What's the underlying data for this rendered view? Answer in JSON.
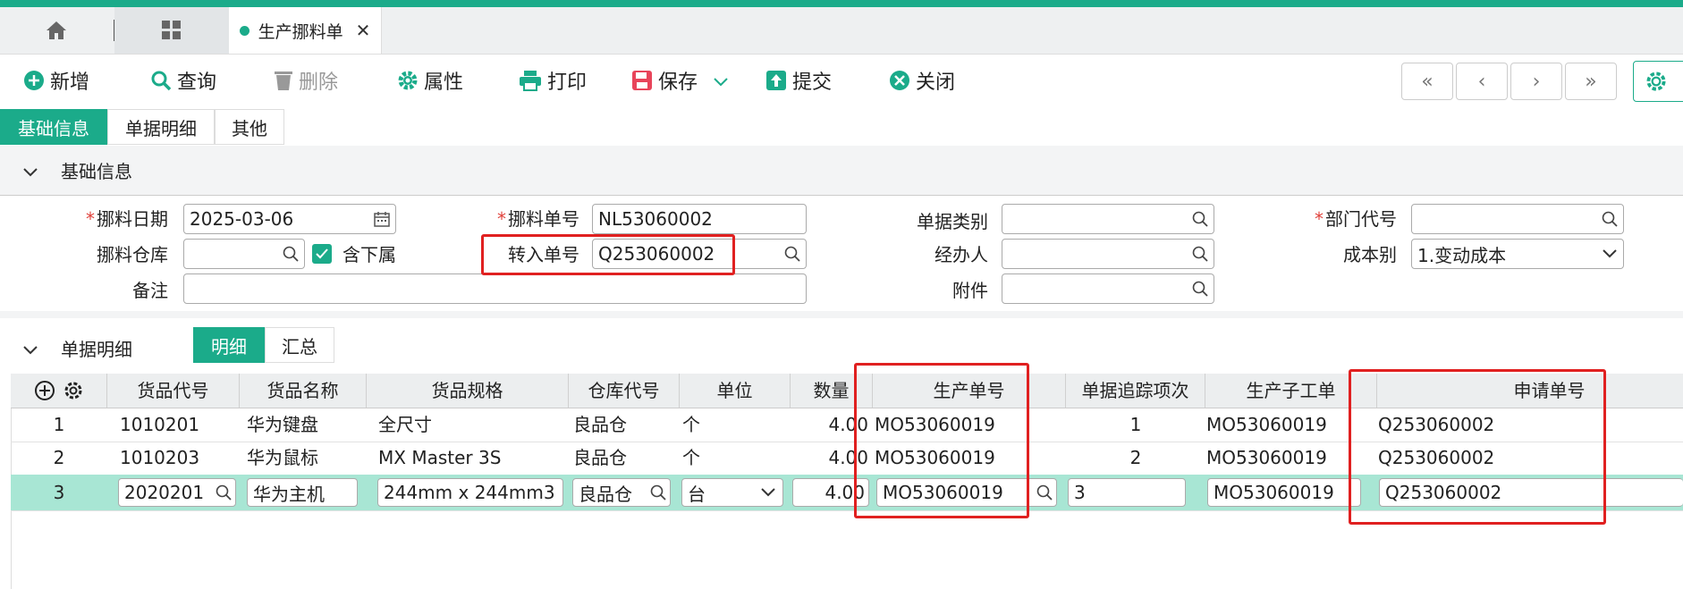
{
  "tabs": {
    "active_label": "生产挪料单"
  },
  "toolbar": {
    "new": "新增",
    "search": "查询",
    "delete": "删除",
    "props": "属性",
    "print": "打印",
    "save": "保存",
    "submit": "提交",
    "close": "关闭"
  },
  "subtabs": [
    "基础信息",
    "单据明细",
    "其他"
  ],
  "section_basic": "基础信息",
  "form": {
    "date_label": "挪料日期",
    "date_value": "2025-03-06",
    "no_label": "挪料单号",
    "no_value": "NL53060002",
    "type_label": "单据类别",
    "type_value": "",
    "dept_label": "部门代号",
    "dept_value": "",
    "wh_label": "挪料仓库",
    "wh_value": "",
    "include_sub_label": "含下属",
    "include_sub_checked": true,
    "transfer_label": "转入单号",
    "transfer_value": "Q253060002",
    "handler_label": "经办人",
    "handler_value": "",
    "cost_label": "成本别",
    "cost_value": "1.变动成本",
    "remark_label": "备注",
    "remark_value": "",
    "attach_label": "附件",
    "attach_value": ""
  },
  "section_detail": "单据明细",
  "detail_tabs": [
    "明细",
    "汇总"
  ],
  "table": {
    "headers": [
      "货品代号",
      "货品名称",
      "货品规格",
      "仓库代号",
      "单位",
      "数量",
      "生产单号",
      "单据追踪项次",
      "生产子工单",
      "申请单号"
    ],
    "rows": [
      {
        "idx": "1",
        "code": "1010201",
        "name": "华为键盘",
        "spec": "全尺寸",
        "wh": "良品仓",
        "unit": "个",
        "qty": "4.00",
        "mo": "MO53060019",
        "trace": "1",
        "sub": "MO53060019",
        "req": "Q253060002"
      },
      {
        "idx": "2",
        "code": "1010203",
        "name": "华为鼠标",
        "spec": "MX Master 3S",
        "wh": "良品仓",
        "unit": "个",
        "qty": "4.00",
        "mo": "MO53060019",
        "trace": "2",
        "sub": "MO53060019",
        "req": "Q253060002"
      },
      {
        "idx": "3",
        "code": "2020201",
        "name": "华为主机",
        "spec": "244mm x 244mm3",
        "wh": "良品仓",
        "unit": "台",
        "qty": "4.00",
        "mo": "MO53060019",
        "trace": "3",
        "sub": "MO53060019",
        "req": "Q253060002"
      }
    ]
  },
  "colors": {
    "accent": "#1bab8a",
    "highlight": "#e02020",
    "selected_row": "#a8e6d4"
  }
}
